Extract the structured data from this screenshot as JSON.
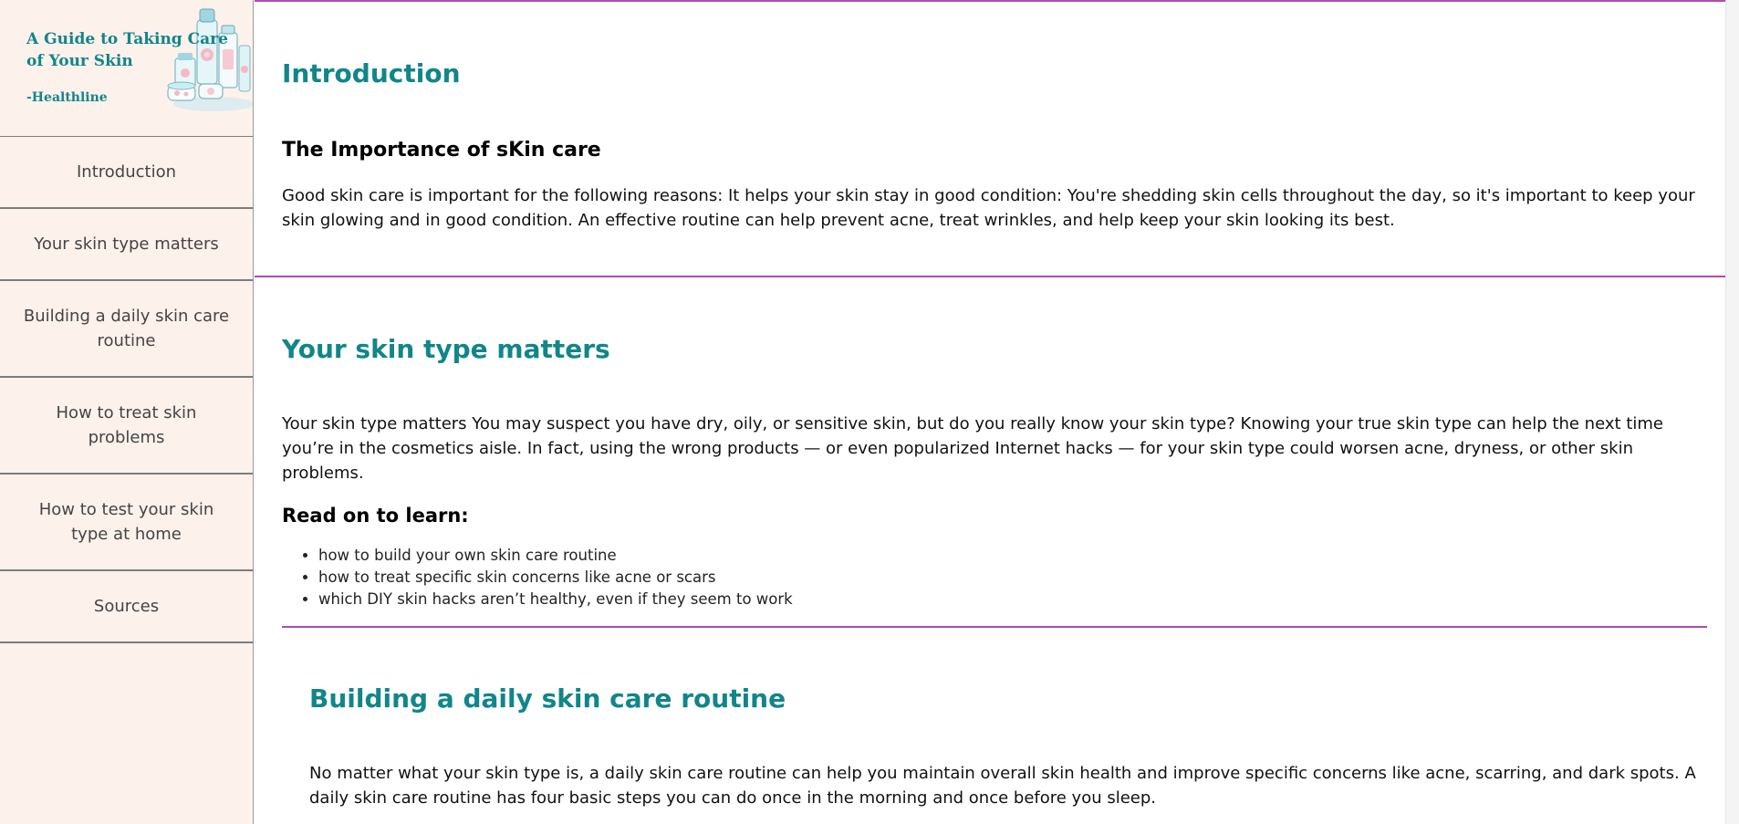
{
  "nav": {
    "title": "A Guide to Taking Care of Your Skin",
    "credit": "-Healthline",
    "items": [
      {
        "label": "Introduction"
      },
      {
        "label": "Your skin type matters"
      },
      {
        "label": "Building a daily skin care routine"
      },
      {
        "label": "How to treat skin problems"
      },
      {
        "label": "How to test your skin type at home"
      },
      {
        "label": "Sources"
      }
    ]
  },
  "sections": {
    "introduction": {
      "heading": "Introduction",
      "subheading": "The Importance of sKin care",
      "body": "Good skin care is important for the following reasons: It helps your skin stay in good condition: You're shedding skin cells throughout the day, so it's important to keep your skin glowing and in good condition. An effective routine can help prevent acne, treat wrinkles, and help keep your skin looking its best."
    },
    "skin_type": {
      "heading": "Your skin type matters",
      "body": "Your skin type matters You may suspect you have dry, oily, or sensitive skin, but do you really know your skin type? Knowing your true skin type can help the next time you’re in the cosmetics aisle. In fact, using the wrong products — or even popularized Internet hacks — for your skin type could worsen acne, dryness, or other skin problems.",
      "subheading": "Read on to learn:",
      "list": [
        "how to build your own skin care routine",
        "how to treat specific skin concerns like acne or scars",
        "which DIY skin hacks aren’t healthy, even if they seem to work"
      ]
    },
    "routine": {
      "heading": "Building a daily skin care routine",
      "body": "No matter what your skin type is, a daily skin care routine can help you maintain overall skin health and improve specific concerns like acne, scarring, and dark spots. A daily skin care routine has four basic steps you can do once in the morning and once before you sleep."
    }
  },
  "colors": {
    "accent_teal": "#10868a",
    "rule_magenta": "#b04ab0",
    "sidebar_bg": "#fdf1ec"
  }
}
